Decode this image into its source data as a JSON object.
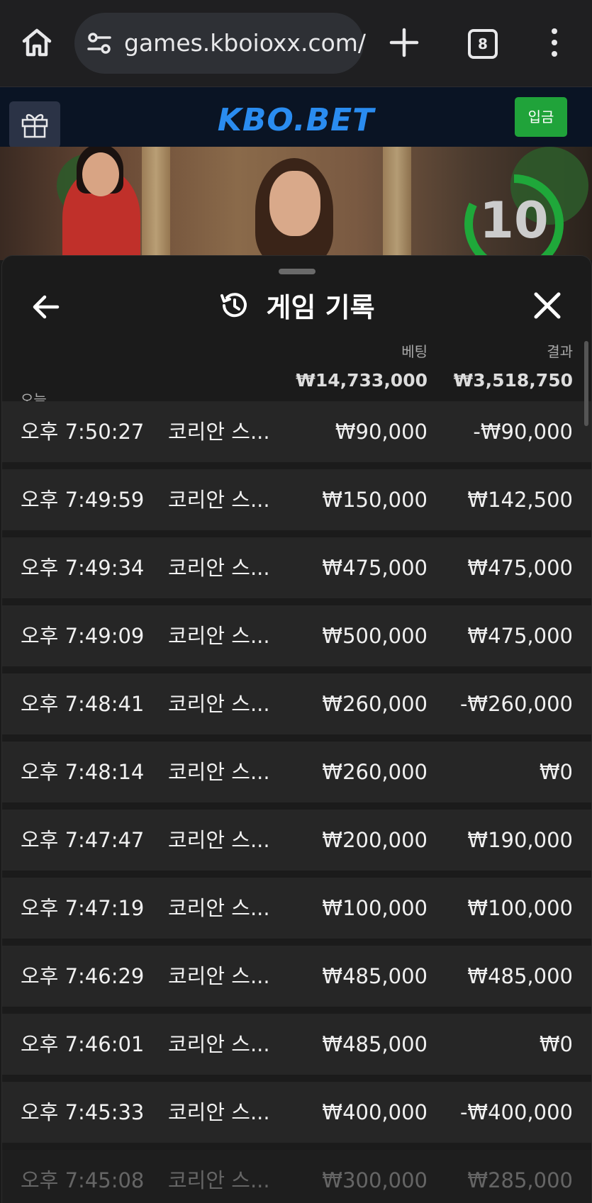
{
  "browser": {
    "url": "games.kboioxx.com/",
    "tab_count": "8"
  },
  "site": {
    "logo": "KBO.BET",
    "deposit_label": "입금"
  },
  "video": {
    "countdown": "10"
  },
  "history": {
    "title": "게임 기록",
    "today_label": "오늘",
    "bet_label": "베팅",
    "result_label": "결과",
    "bet_total": "₩14,733,000",
    "result_total": "₩3,518,750",
    "rows": [
      {
        "time": "오후 7:50:27",
        "game": "코리안 스...",
        "bet": "₩90,000",
        "result": "-₩90,000"
      },
      {
        "time": "오후 7:49:59",
        "game": "코리안 스...",
        "bet": "₩150,000",
        "result": "₩142,500"
      },
      {
        "time": "오후 7:49:34",
        "game": "코리안 스...",
        "bet": "₩475,000",
        "result": "₩475,000"
      },
      {
        "time": "오후 7:49:09",
        "game": "코리안 스...",
        "bet": "₩500,000",
        "result": "₩475,000"
      },
      {
        "time": "오후 7:48:41",
        "game": "코리안 스...",
        "bet": "₩260,000",
        "result": "-₩260,000"
      },
      {
        "time": "오후 7:48:14",
        "game": "코리안 스...",
        "bet": "₩260,000",
        "result": "₩0"
      },
      {
        "time": "오후 7:47:47",
        "game": "코리안 스...",
        "bet": "₩200,000",
        "result": "₩190,000"
      },
      {
        "time": "오후 7:47:19",
        "game": "코리안 스...",
        "bet": "₩100,000",
        "result": "₩100,000"
      },
      {
        "time": "오후 7:46:29",
        "game": "코리안 스...",
        "bet": "₩485,000",
        "result": "₩485,000"
      },
      {
        "time": "오후 7:46:01",
        "game": "코리안 스...",
        "bet": "₩485,000",
        "result": "₩0"
      },
      {
        "time": "오후 7:45:33",
        "game": "코리안 스...",
        "bet": "₩400,000",
        "result": "-₩400,000"
      },
      {
        "time": "오후 7:45:08",
        "game": "코리안 스...",
        "bet": "₩300,000",
        "result": "₩285,000"
      }
    ]
  },
  "colors": {
    "accent_blue": "#2a8cf0",
    "deposit_green": "#20a33a",
    "timer_green": "#1fa83a"
  },
  "icons": {
    "home": "home-icon",
    "site_info": "tune-icon",
    "new_tab": "plus-icon",
    "tabs": "tab-count-icon",
    "menu": "more-vert-icon",
    "gift": "gift-icon",
    "back": "arrow-left-icon",
    "history": "history-icon",
    "close": "close-icon"
  }
}
